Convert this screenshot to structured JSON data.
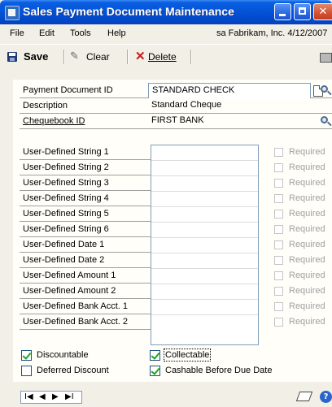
{
  "window": {
    "title": "Sales Payment Document Maintenance"
  },
  "menu": {
    "items": [
      "File",
      "Edit",
      "Tools",
      "Help"
    ],
    "user_info": "sa  Fabrikam, Inc.  4/12/2007"
  },
  "toolbar": {
    "save_label": "Save",
    "clear_label": "Clear",
    "delete_label": "Delete"
  },
  "form": {
    "payment_document_id": {
      "label": "Payment Document ID",
      "value": "STANDARD CHECK"
    },
    "description": {
      "label": "Description",
      "value": "Standard Cheque"
    },
    "chequebook_id": {
      "label": "Chequebook ID",
      "value": "FIRST BANK"
    }
  },
  "user_defined": {
    "fields": [
      "User-Defined String 1",
      "User-Defined String 2",
      "User-Defined String 3",
      "User-Defined String 4",
      "User-Defined String 5",
      "User-Defined String 6",
      "User-Defined Date 1",
      "User-Defined Date 2",
      "User-Defined Amount 1",
      "User-Defined Amount 2",
      "User-Defined Bank Acct. 1",
      "User-Defined Bank Acct. 2"
    ],
    "required_label": "Required"
  },
  "options": {
    "discountable": {
      "label": "Discountable",
      "checked": true
    },
    "deferred_discount": {
      "label": "Deferred Discount",
      "checked": false
    },
    "collectable": {
      "label": "Collectable",
      "checked": true
    },
    "cashable": {
      "label": "Cashable Before Due Date",
      "checked": true
    }
  },
  "nav": {
    "first": "I◀",
    "prev": "◀",
    "next": "▶",
    "last": "▶I"
  },
  "help": {
    "glyph": "?"
  }
}
